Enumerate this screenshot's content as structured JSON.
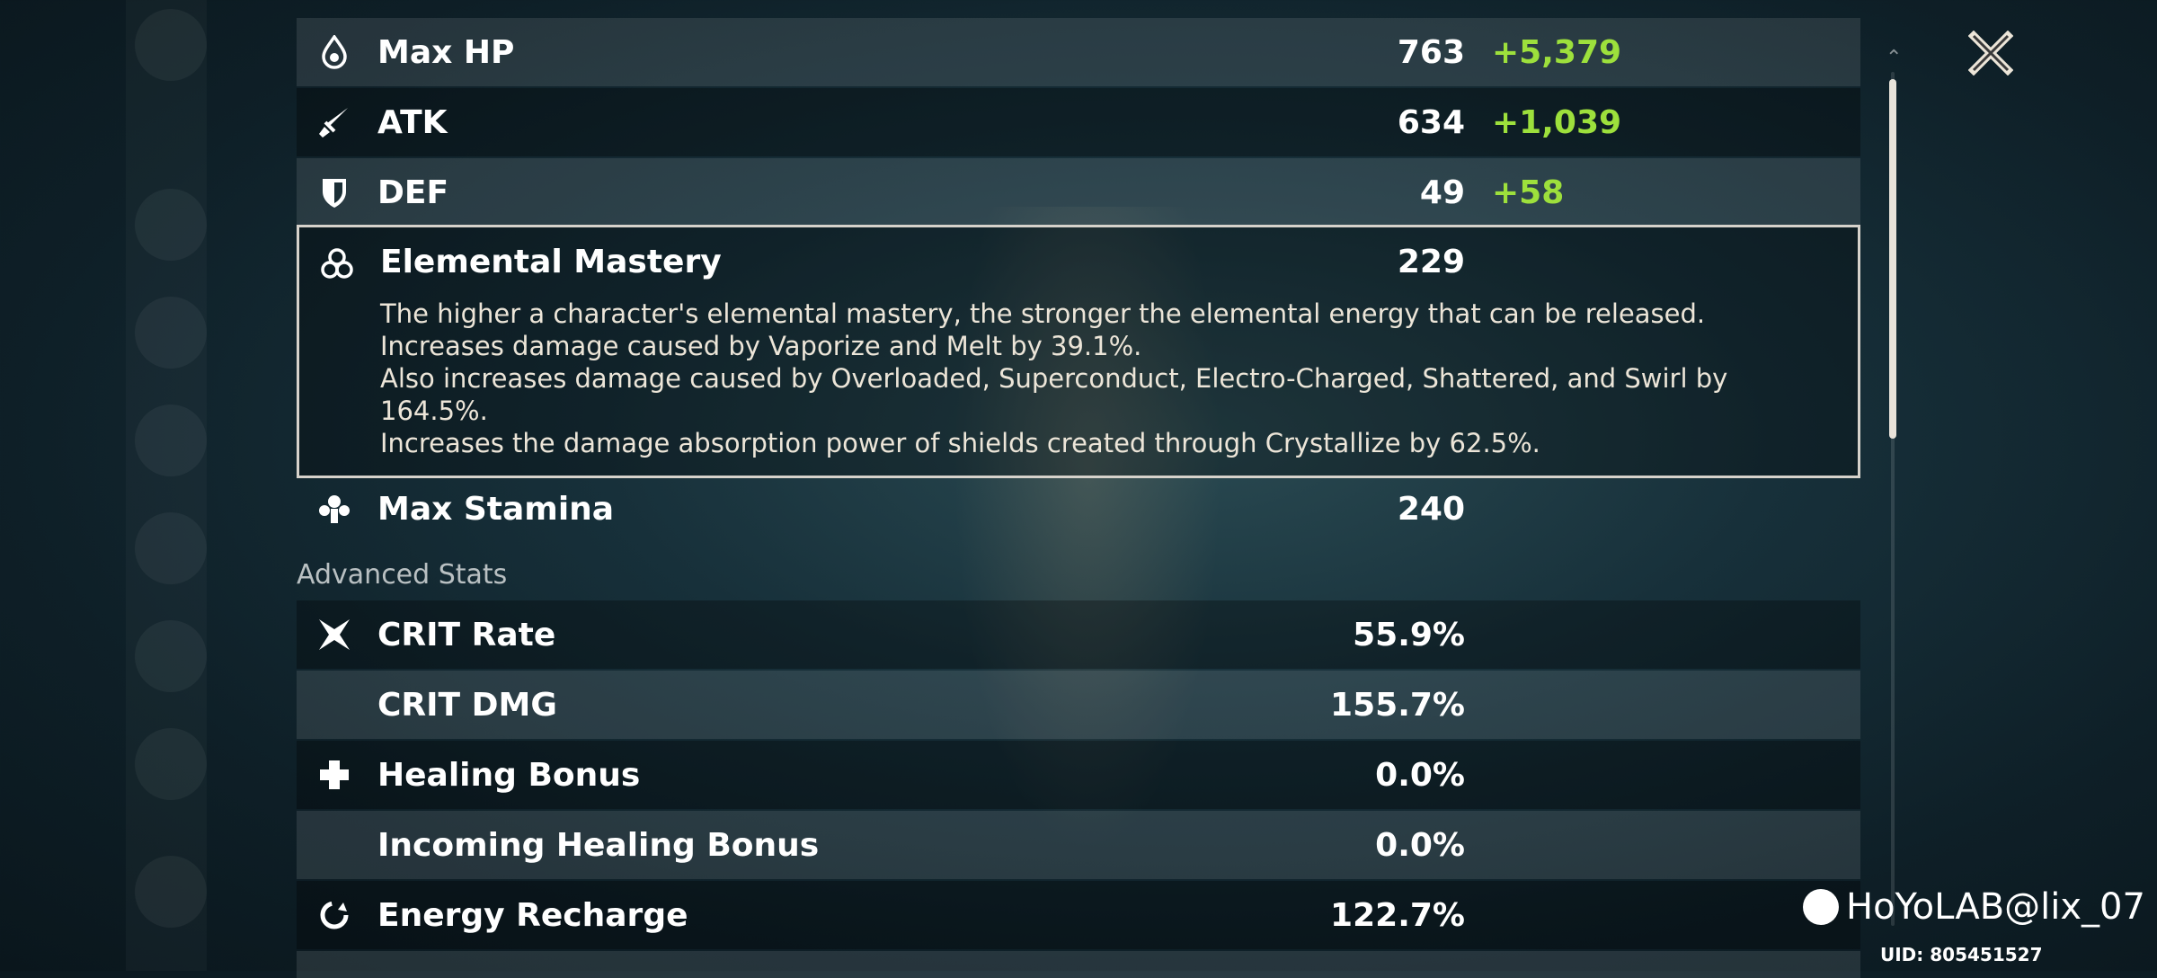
{
  "stats": {
    "max_hp": {
      "label": "Max HP",
      "base": "763",
      "bonus": "+5,379",
      "icon": "water-drop-icon"
    },
    "atk": {
      "label": "ATK",
      "base": "634",
      "bonus": "+1,039",
      "icon": "sword-icon"
    },
    "def": {
      "label": "DEF",
      "base": "49",
      "bonus": "+58",
      "icon": "shield-icon"
    },
    "elemental_mastery": {
      "label": "Elemental Mastery",
      "value": "229",
      "icon": "triple-ring-icon",
      "description": [
        "The higher a character's elemental mastery, the stronger the elemental energy that can be released.",
        "Increases damage caused by Vaporize and Melt by 39.1%.",
        "Also increases damage caused by Overloaded, Superconduct, Electro-Charged, Shattered, and Swirl by 164.5%.",
        "Increases the damage absorption power of shields created through Crystallize by 62.5%."
      ]
    },
    "max_stamina": {
      "label": "Max Stamina",
      "value": "240",
      "icon": "stamina-icon"
    }
  },
  "advanced": {
    "title": "Advanced Stats",
    "crit_rate": {
      "label": "CRIT Rate",
      "value": "55.9%",
      "icon": "crit-star-icon"
    },
    "crit_dmg": {
      "label": "CRIT DMG",
      "value": "155.7%"
    },
    "healing_bonus": {
      "label": "Healing Bonus",
      "value": "0.0%",
      "icon": "plus-icon"
    },
    "incoming_healing": {
      "label": "Incoming Healing Bonus",
      "value": "0.0%"
    },
    "energy_recharge": {
      "label": "Energy Recharge",
      "value": "122.7%",
      "icon": "recharge-icon"
    }
  },
  "watermark": {
    "text": "HoYoLAB@lix_07",
    "uid": "UID: 805451527"
  },
  "colors": {
    "bonus": "#9de03c",
    "text": "#ffffff",
    "desc": "#ece5d8"
  }
}
